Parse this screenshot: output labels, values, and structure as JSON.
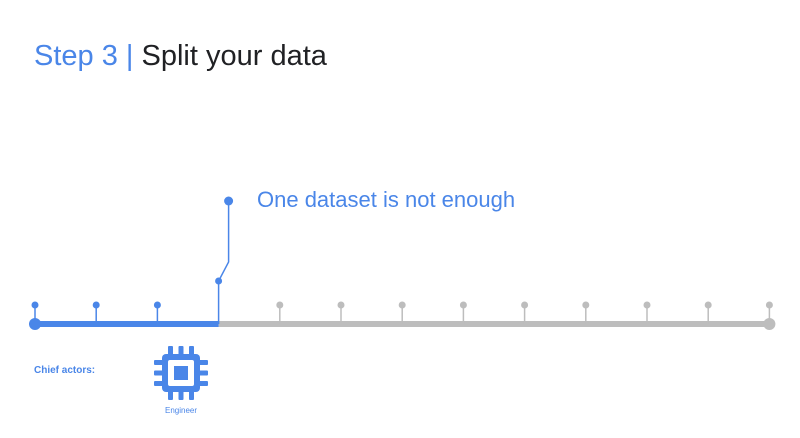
{
  "title": {
    "step": "Step 3",
    "separator": "|",
    "text": "Split your data"
  },
  "callout": "One dataset is not enough",
  "actors": {
    "label": "Chief actors:",
    "items": [
      {
        "name": "Engineer",
        "icon": "chip-icon"
      }
    ]
  },
  "timeline": {
    "total_steps": 13,
    "current_step": 3
  },
  "colors": {
    "active": "#4a86e8",
    "inactive": "#bdbdbd",
    "title_text": "#202124"
  }
}
